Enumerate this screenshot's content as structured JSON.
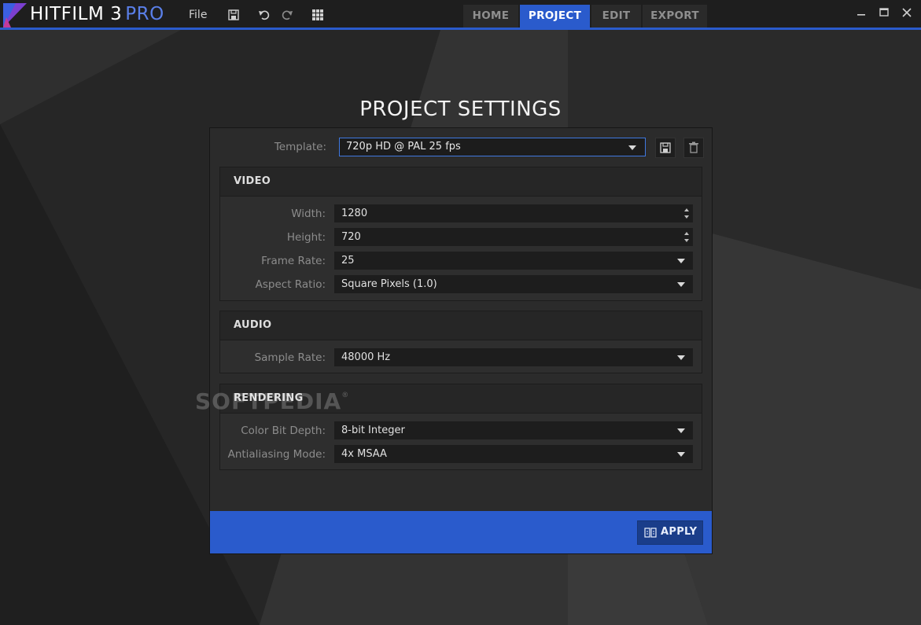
{
  "app": {
    "brand_main": "HITFILM 3",
    "brand_suffix": "PRO",
    "accent": "#2a5bcc"
  },
  "menu": {
    "file_label": "File",
    "icons": [
      "save-icon",
      "undo-icon",
      "redo-icon",
      "grid-icon"
    ]
  },
  "tabs": [
    {
      "label": "HOME",
      "active": false
    },
    {
      "label": "PROJECT",
      "active": true
    },
    {
      "label": "EDIT",
      "active": false
    },
    {
      "label": "EXPORT",
      "active": false
    }
  ],
  "window_controls": [
    "minimize-icon",
    "maximize-icon",
    "close-icon"
  ],
  "page": {
    "title": "PROJECT SETTINGS"
  },
  "template": {
    "label": "Template:",
    "value": "720p HD @ PAL 25 fps"
  },
  "video": {
    "heading": "VIDEO",
    "width_label": "Width:",
    "width_value": "1280",
    "height_label": "Height:",
    "height_value": "720",
    "frame_rate_label": "Frame Rate:",
    "frame_rate_value": "25",
    "aspect_label": "Aspect Ratio:",
    "aspect_value": "Square Pixels (1.0)"
  },
  "audio": {
    "heading": "AUDIO",
    "sample_rate_label": "Sample Rate:",
    "sample_rate_value": "48000 Hz"
  },
  "rendering": {
    "heading": "RENDERING",
    "color_depth_label": "Color Bit Depth:",
    "color_depth_value": "8-bit Integer",
    "antialias_label": "Antialiasing Mode:",
    "antialias_value": "4x MSAA"
  },
  "footer": {
    "apply_label": "APPLY"
  },
  "watermark": {
    "text": "SOFTPEDIA",
    "mark": "®"
  }
}
